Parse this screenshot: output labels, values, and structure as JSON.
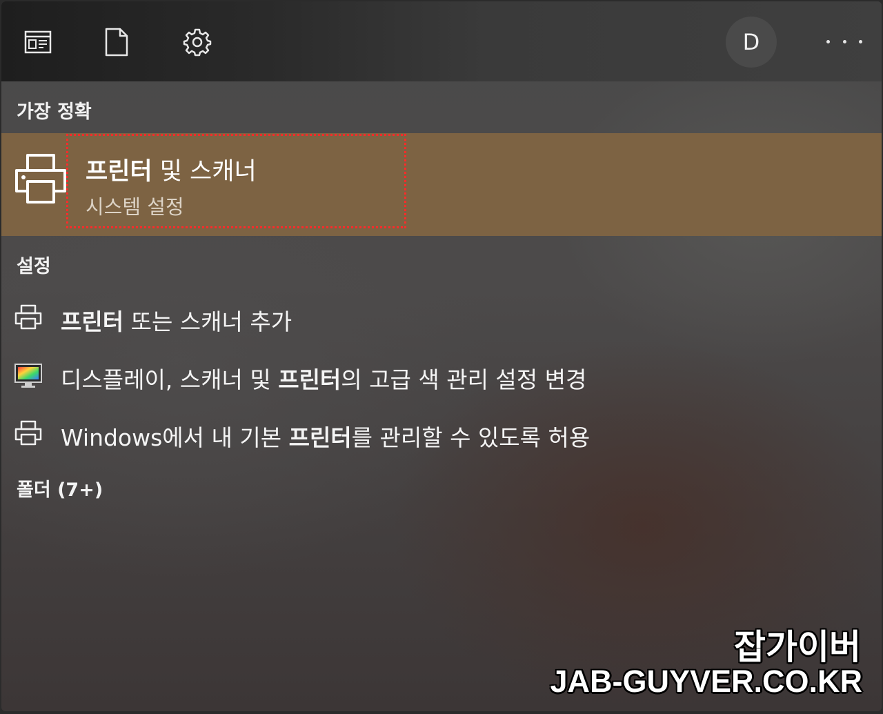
{
  "toolbar": {
    "icons": [
      "app-window-icon",
      "document-icon",
      "gear-icon"
    ],
    "avatar_initial": "D",
    "more_icon": "more-ellipsis-icon"
  },
  "sections": {
    "best_match": "가장 정확",
    "settings": "설정",
    "folders": "폴더 (7+)"
  },
  "best_match": {
    "icon": "printer-icon",
    "title_bold": "프린터",
    "title_rest": " 및 스캐너",
    "subtitle": "시스템 설정",
    "highlight_color": "#ff2a2a"
  },
  "results": [
    {
      "icon": "printer-icon",
      "pre": "",
      "bold": "프린터",
      "post": " 또는 스캐너 추가"
    },
    {
      "icon": "display-color-icon",
      "pre": "디스플레이, 스캐너 및 ",
      "bold": "프린터",
      "post": "의 고급 색 관리 설정 변경"
    },
    {
      "icon": "printer-icon",
      "pre": "Windows에서 내 기본 ",
      "bold": "프린터",
      "post": "를 관리할 수 있도록 허용"
    }
  ],
  "watermark": {
    "line1": "잡가이버",
    "line2": "JAB-GUYVER.CO.KR"
  },
  "colors": {
    "best_match_bg": "#80644 2",
    "accent": "#806442"
  }
}
